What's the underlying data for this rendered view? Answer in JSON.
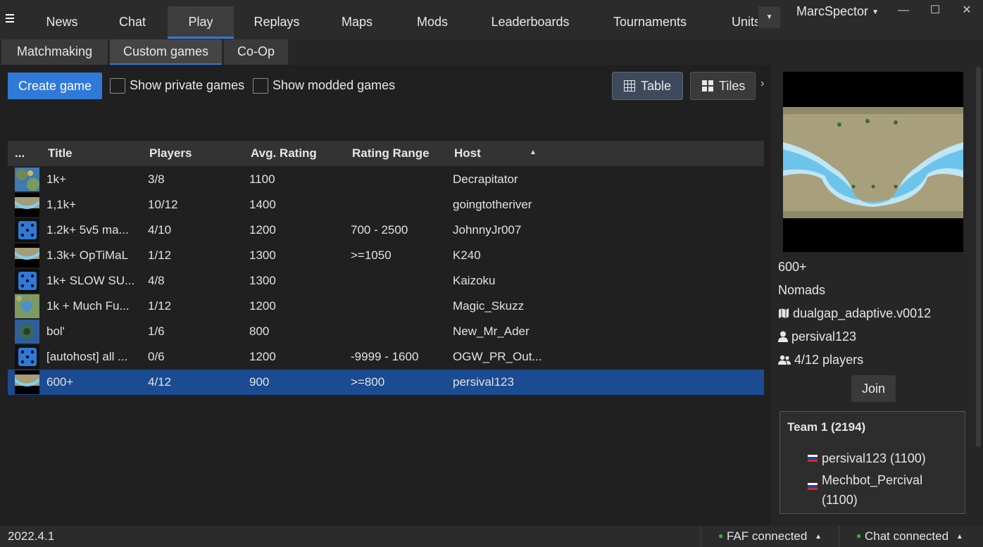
{
  "nav": {
    "tabs": [
      "News",
      "Chat",
      "Play",
      "Replays",
      "Maps",
      "Mods",
      "Leaderboards",
      "Tournaments",
      "Units"
    ],
    "active": "Play",
    "username": "MarcSpector"
  },
  "subnav": {
    "tabs": [
      "Matchmaking",
      "Custom games",
      "Co-Op"
    ],
    "active": "Custom games"
  },
  "toolbar": {
    "create_game": "Create game",
    "show_private": "Show private games",
    "show_modded": "Show modded games",
    "table": "Table",
    "tiles": "Tiles"
  },
  "table": {
    "headers": [
      "...",
      "Title",
      "Players",
      "Avg. Rating",
      "Rating Range",
      "Host"
    ],
    "rows": [
      {
        "thumb": "map",
        "title": "1k+",
        "players": "3/8",
        "avg": "1100",
        "range": "",
        "host": "Decrapitator"
      },
      {
        "thumb": "river",
        "title": "1,1k+",
        "players": "10/12",
        "avg": "1400",
        "range": "",
        "host": "goingtotheriver"
      },
      {
        "thumb": "dice",
        "title": "1.2k+ 5v5 ma...",
        "players": "4/10",
        "avg": "1200",
        "range": "700 - 2500",
        "host": "JohnnyJr007"
      },
      {
        "thumb": "river",
        "title": "1.3k+ OpTiMaL",
        "players": "1/12",
        "avg": "1300",
        "range": ">=1050",
        "host": "K240"
      },
      {
        "thumb": "dice",
        "title": "1k+ SLOW SU...",
        "players": "4/8",
        "avg": "1300",
        "range": "",
        "host": "Kaizoku"
      },
      {
        "thumb": "map2",
        "title": "1k + Much Fu...",
        "players": "1/12",
        "avg": "1200",
        "range": "",
        "host": "Magic_Skuzz"
      },
      {
        "thumb": "map3",
        "title": "bol'",
        "players": "1/6",
        "avg": "800",
        "range": "",
        "host": "New_Mr_Ader"
      },
      {
        "thumb": "dice",
        "title": "[autohost] all ...",
        "players": "0/6",
        "avg": "1200",
        "range": "-9999 - 1600",
        "host": "OGW_PR_Out..."
      },
      {
        "thumb": "river",
        "title": "600+",
        "players": "4/12",
        "avg": "900",
        "range": ">=800",
        "host": "persival123"
      }
    ],
    "selected_index": 8
  },
  "details": {
    "title": "600+",
    "mode": "Nomads",
    "map": "dualgap_adaptive.v0012",
    "host": "persival123",
    "players": "4/12 players",
    "join": "Join",
    "team_title": "Team 1 (2194)",
    "team_players": [
      "persival123 (1100)",
      "Mechbot_Percival (1100)"
    ]
  },
  "status": {
    "version": "2022.4.1",
    "faf": "FAF connected",
    "chat": "Chat connected"
  },
  "colors": {
    "accent": "#2f79d9",
    "selected_row": "#1b4b90",
    "online": "#3cb043"
  }
}
